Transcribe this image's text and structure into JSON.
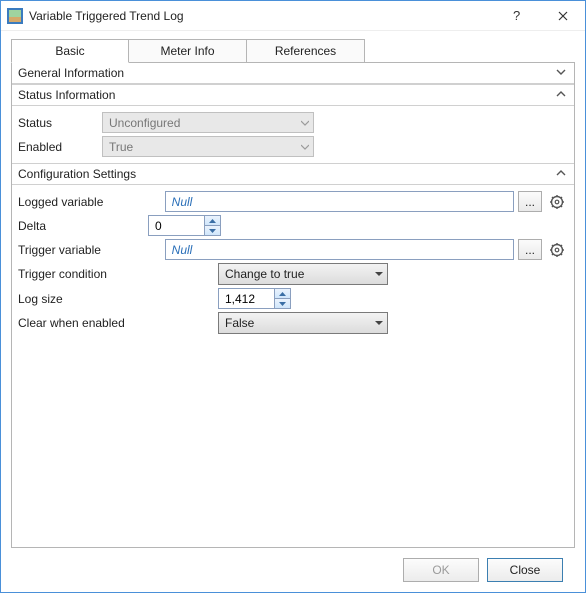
{
  "window": {
    "title": "Variable Triggered Trend Log"
  },
  "tabs": {
    "basic": "Basic",
    "meter": "Meter Info",
    "references": "References"
  },
  "sections": {
    "general": "General Information",
    "status": "Status Information",
    "config": "Configuration Settings"
  },
  "status": {
    "status_label": "Status",
    "status_value": "Unconfigured",
    "enabled_label": "Enabled",
    "enabled_value": "True"
  },
  "config": {
    "logged_variable_label": "Logged variable",
    "logged_variable_value": "Null",
    "delta_label": "Delta",
    "delta_value": "0",
    "trigger_variable_label": "Trigger variable",
    "trigger_variable_value": "Null",
    "trigger_condition_label": "Trigger condition",
    "trigger_condition_value": "Change to true",
    "log_size_label": "Log size",
    "log_size_value": "1,412",
    "clear_when_enabled_label": "Clear when enabled",
    "clear_when_enabled_value": "False"
  },
  "buttons": {
    "ok": "OK",
    "close": "Close",
    "browse": "..."
  }
}
